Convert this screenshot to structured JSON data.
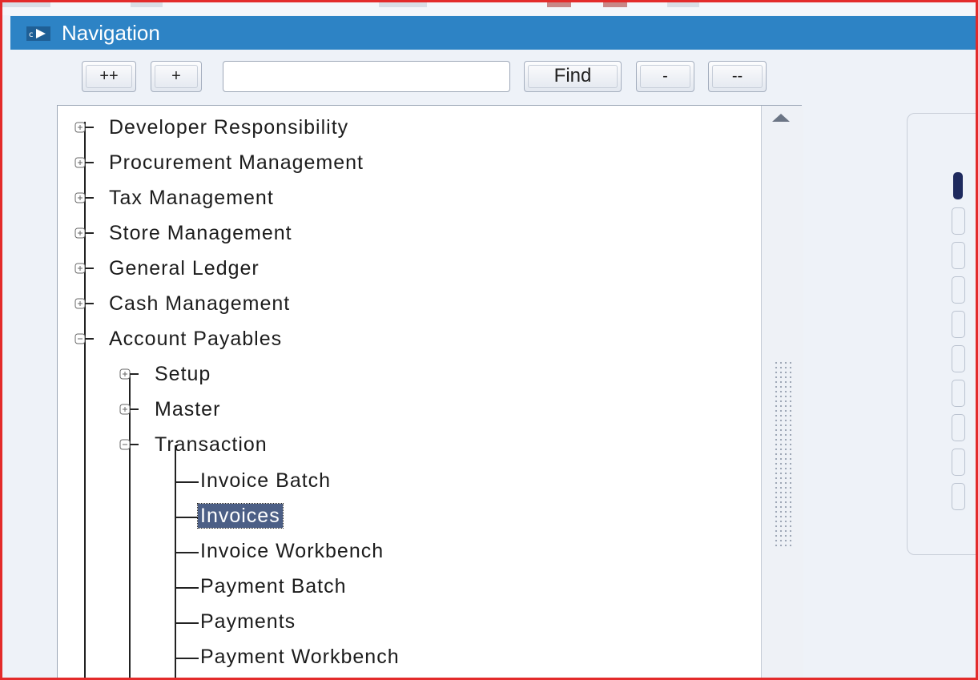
{
  "window": {
    "title": "Navigation"
  },
  "toolbar": {
    "expand_all_label": "++",
    "expand_label": "+",
    "search_value": "",
    "find_label": "Find",
    "collapse_label": "-",
    "collapse_all_label": "--"
  },
  "tree": {
    "roots": [
      {
        "label": "Developer Responsibility",
        "expanded": false
      },
      {
        "label": "Procurement Management",
        "expanded": false
      },
      {
        "label": "Tax Management",
        "expanded": false
      },
      {
        "label": "Store Management",
        "expanded": false
      },
      {
        "label": "General Ledger",
        "expanded": false
      },
      {
        "label": "Cash Management",
        "expanded": false
      },
      {
        "label": "Account Payables",
        "expanded": true
      }
    ],
    "account_payables_children": [
      {
        "label": "Setup",
        "expanded": false
      },
      {
        "label": "Master",
        "expanded": false
      },
      {
        "label": "Transaction",
        "expanded": true
      }
    ],
    "transaction_items": [
      {
        "label": "Invoice Batch",
        "selected": false
      },
      {
        "label": "Invoices",
        "selected": true
      },
      {
        "label": "Invoice Workbench",
        "selected": false
      },
      {
        "label": "Payment Batch",
        "selected": false
      },
      {
        "label": "Payments",
        "selected": false
      },
      {
        "label": "Payment Workbench",
        "selected": false
      }
    ]
  },
  "colors": {
    "titlebar": "#2d83c5",
    "selection": "#4c5f86",
    "frame_border": "#e32b2b"
  }
}
